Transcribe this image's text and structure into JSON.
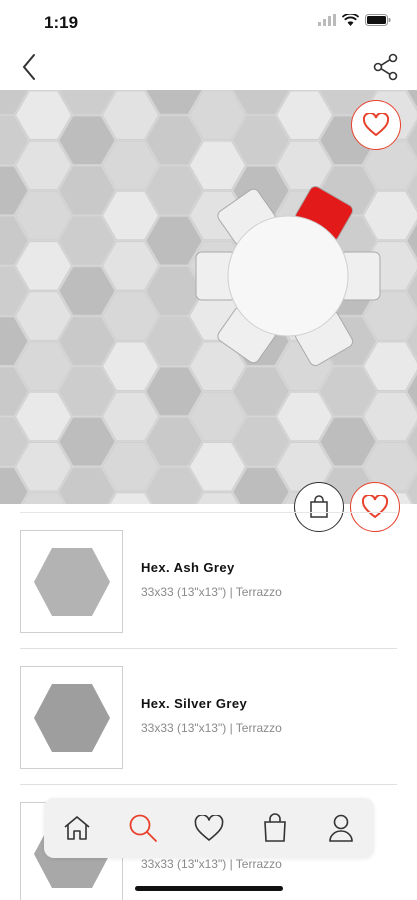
{
  "status": {
    "time": "1:19"
  },
  "colors": {
    "accent": "#e8412c",
    "chair_red": "#e21a1a"
  },
  "icons": {
    "back": "chevron-left-icon",
    "share": "share-icon",
    "favorite": "heart-icon",
    "bag": "shopping-bag-icon",
    "home": "home-icon",
    "search": "search-icon",
    "user": "user-icon"
  },
  "products": [
    {
      "name": "Hex. Ash Grey",
      "meta": "33x33 (13\"x13\") | Terrazzo",
      "tile_color": "#b3b3b3"
    },
    {
      "name": "Hex. Silver Grey",
      "meta": "33x33 (13\"x13\") | Terrazzo",
      "tile_color": "#9e9e9e"
    },
    {
      "name": "",
      "meta": "33x33 (13\"x13\") | Terrazzo",
      "tile_color": "#a8a8a8"
    }
  ],
  "tabbar": {
    "active": "search"
  }
}
